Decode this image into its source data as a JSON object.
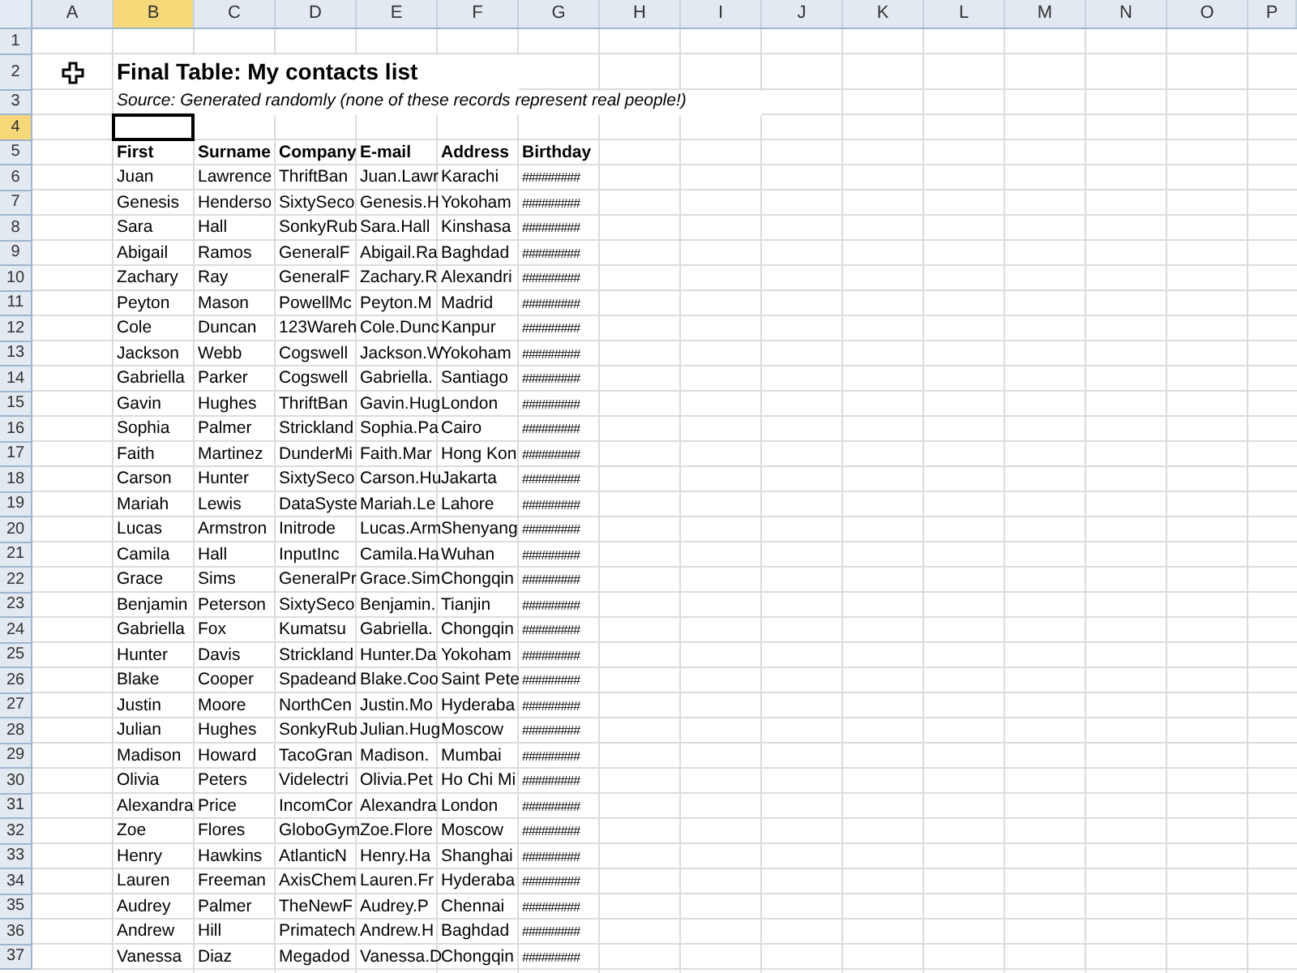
{
  "columns": [
    {
      "label": "A",
      "selected": false
    },
    {
      "label": "B",
      "selected": true
    },
    {
      "label": "C",
      "selected": false
    },
    {
      "label": "D",
      "selected": false
    },
    {
      "label": "E",
      "selected": false
    },
    {
      "label": "F",
      "selected": false
    },
    {
      "label": "G",
      "selected": false
    },
    {
      "label": "H",
      "selected": false
    },
    {
      "label": "I",
      "selected": false
    },
    {
      "label": "J",
      "selected": false
    },
    {
      "label": "K",
      "selected": false
    },
    {
      "label": "L",
      "selected": false
    },
    {
      "label": "M",
      "selected": false
    },
    {
      "label": "N",
      "selected": false
    },
    {
      "label": "O",
      "selected": false
    },
    {
      "label": "P",
      "selected": false
    }
  ],
  "row_headers": [
    {
      "label": "1",
      "selected": false
    },
    {
      "label": "2",
      "selected": false
    },
    {
      "label": "3",
      "selected": false
    },
    {
      "label": "4",
      "selected": true
    },
    {
      "label": "5",
      "selected": false
    },
    {
      "label": "6",
      "selected": false
    },
    {
      "label": "7",
      "selected": false
    },
    {
      "label": "8",
      "selected": false
    },
    {
      "label": "9",
      "selected": false
    },
    {
      "label": "10",
      "selected": false
    },
    {
      "label": "11",
      "selected": false
    },
    {
      "label": "12",
      "selected": false
    },
    {
      "label": "13",
      "selected": false
    },
    {
      "label": "14",
      "selected": false
    },
    {
      "label": "15",
      "selected": false
    },
    {
      "label": "16",
      "selected": false
    },
    {
      "label": "17",
      "selected": false
    },
    {
      "label": "18",
      "selected": false
    },
    {
      "label": "19",
      "selected": false
    },
    {
      "label": "20",
      "selected": false
    },
    {
      "label": "21",
      "selected": false
    },
    {
      "label": "22",
      "selected": false
    },
    {
      "label": "23",
      "selected": false
    },
    {
      "label": "24",
      "selected": false
    },
    {
      "label": "25",
      "selected": false
    },
    {
      "label": "26",
      "selected": false
    },
    {
      "label": "27",
      "selected": false
    },
    {
      "label": "28",
      "selected": false
    },
    {
      "label": "29",
      "selected": false
    },
    {
      "label": "30",
      "selected": false
    },
    {
      "label": "31",
      "selected": false
    },
    {
      "label": "32",
      "selected": false
    },
    {
      "label": "33",
      "selected": false
    },
    {
      "label": "34",
      "selected": false
    },
    {
      "label": "35",
      "selected": false
    },
    {
      "label": "36",
      "selected": false
    },
    {
      "label": "37",
      "selected": false
    }
  ],
  "title": "Final Table: My contacts list",
  "source": "Source: Generated randomly (none of these records represent real people!)",
  "table": {
    "columns": [
      "First",
      "Surname",
      "Company",
      "E-mail",
      "Address",
      "Birthday"
    ],
    "rows": [
      [
        "Juan",
        "Lawrence",
        "ThriftBan",
        "Juan.Lawr",
        "Karachi",
        "#########"
      ],
      [
        "Genesis",
        "Henderso",
        "SixtySeco",
        "Genesis.H",
        "Yokoham",
        "#########"
      ],
      [
        "Sara",
        "Hall",
        "SonkyRub",
        "Sara.Hall",
        "Kinshasa",
        "#########"
      ],
      [
        "Abigail",
        "Ramos",
        "GeneralF",
        "Abigail.Ra",
        "Baghdad",
        "#########"
      ],
      [
        "Zachary",
        "Ray",
        "GeneralF",
        "Zachary.R",
        "Alexandri",
        "#########"
      ],
      [
        "Peyton",
        "Mason",
        "PowellMc",
        "Peyton.M",
        "Madrid",
        "#########"
      ],
      [
        "Cole",
        "Duncan",
        "123Wareh",
        "Cole.Dunc",
        "Kanpur",
        "#########"
      ],
      [
        "Jackson",
        "Webb",
        "Cogswell",
        "Jackson.W",
        "Yokoham",
        "#########"
      ],
      [
        "Gabriella",
        "Parker",
        "Cogswell",
        "Gabriella.",
        "Santiago",
        "#########"
      ],
      [
        "Gavin",
        "Hughes",
        "ThriftBan",
        "Gavin.Hug",
        "London",
        "#########"
      ],
      [
        "Sophia",
        "Palmer",
        "Strickland",
        "Sophia.Pa",
        "Cairo",
        "#########"
      ],
      [
        "Faith",
        "Martinez",
        "DunderMi",
        "Faith.Mar",
        "Hong Kon",
        "#########"
      ],
      [
        "Carson",
        "Hunter",
        "SixtySeco",
        "Carson.Hu",
        "Jakarta",
        "#########"
      ],
      [
        "Mariah",
        "Lewis",
        "DataSyste",
        "Mariah.Le",
        "Lahore",
        "#########"
      ],
      [
        "Lucas",
        "Armstron",
        "Initrode",
        "Lucas.Arm",
        "Shenyang",
        "#########"
      ],
      [
        "Camila",
        "Hall",
        "InputInc",
        "Camila.Ha",
        "Wuhan",
        "#########"
      ],
      [
        "Grace",
        "Sims",
        "GeneralPr",
        "Grace.Sim",
        "Chongqin",
        "#########"
      ],
      [
        "Benjamin",
        "Peterson",
        "SixtySeco",
        "Benjamin.",
        "Tianjin",
        "#########"
      ],
      [
        "Gabriella",
        "Fox",
        "Kumatsu",
        "Gabriella.",
        "Chongqin",
        "#########"
      ],
      [
        "Hunter",
        "Davis",
        "Strickland",
        "Hunter.Da",
        "Yokoham",
        "#########"
      ],
      [
        "Blake",
        "Cooper",
        "Spadeand",
        "Blake.Coo",
        "Saint Pete",
        "#########"
      ],
      [
        "Justin",
        "Moore",
        "NorthCen",
        "Justin.Mo",
        "Hyderaba",
        "#########"
      ],
      [
        "Julian",
        "Hughes",
        "SonkyRub",
        "Julian.Hug",
        "Moscow",
        "#########"
      ],
      [
        "Madison",
        "Howard",
        "TacoGran",
        "Madison.",
        "Mumbai",
        "#########"
      ],
      [
        "Olivia",
        "Peters",
        "Videlectri",
        "Olivia.Pet",
        "Ho Chi Mi",
        "#########"
      ],
      [
        "Alexandra",
        "Price",
        "IncomCor",
        "Alexandra",
        "London",
        "#########"
      ],
      [
        "Zoe",
        "Flores",
        "GloboGym",
        "Zoe.Flore",
        "Moscow",
        "#########"
      ],
      [
        "Henry",
        "Hawkins",
        "AtlanticN",
        "Henry.Ha",
        "Shanghai",
        "#########"
      ],
      [
        "Lauren",
        "Freeman",
        "AxisChem",
        "Lauren.Fr",
        "Hyderaba",
        "#########"
      ],
      [
        "Audrey",
        "Palmer",
        "TheNewF",
        "Audrey.P",
        "Chennai",
        "#########"
      ],
      [
        "Andrew",
        "Hill",
        "Primatech",
        "Andrew.H",
        "Baghdad",
        "#########"
      ],
      [
        "Vanessa",
        "Diaz",
        "Megadod",
        "Vanessa.D",
        "Chongqin",
        "#########"
      ]
    ]
  }
}
